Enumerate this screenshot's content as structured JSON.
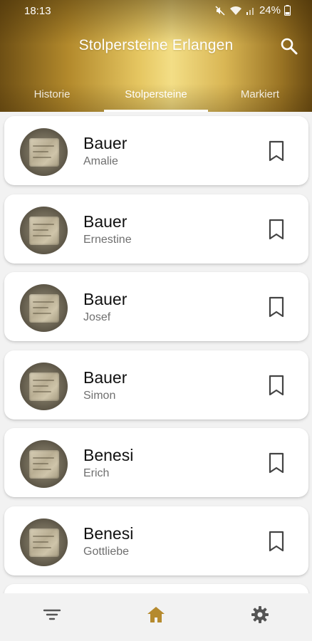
{
  "status_bar": {
    "time": "18:13",
    "battery": "24%",
    "icons": [
      "mute-icon",
      "wifi-icon",
      "signal-icon",
      "battery-icon"
    ]
  },
  "header": {
    "title": "Stolpersteine Erlangen",
    "search_icon": "search-icon"
  },
  "tabs": [
    {
      "label": "Historie",
      "active": false
    },
    {
      "label": "Stolpersteine",
      "active": true
    },
    {
      "label": "Markiert",
      "active": false
    }
  ],
  "items": [
    {
      "last_name": "Bauer",
      "first_name": "Amalie",
      "bookmarked": false
    },
    {
      "last_name": "Bauer",
      "first_name": "Ernestine",
      "bookmarked": false
    },
    {
      "last_name": "Bauer",
      "first_name": "Josef",
      "bookmarked": false
    },
    {
      "last_name": "Bauer",
      "first_name": "Simon",
      "bookmarked": false
    },
    {
      "last_name": "Benesi",
      "first_name": "Erich",
      "bookmarked": false
    },
    {
      "last_name": "Benesi",
      "first_name": "Gottliebe",
      "bookmarked": false
    }
  ],
  "bottom_nav": [
    {
      "icon": "filter-icon",
      "active": false
    },
    {
      "icon": "home-icon",
      "active": true
    },
    {
      "icon": "settings-icon",
      "active": false
    }
  ],
  "colors": {
    "accent": "#b58a2e",
    "nav_inactive": "#555555",
    "subtitle": "#6f6f6f"
  }
}
